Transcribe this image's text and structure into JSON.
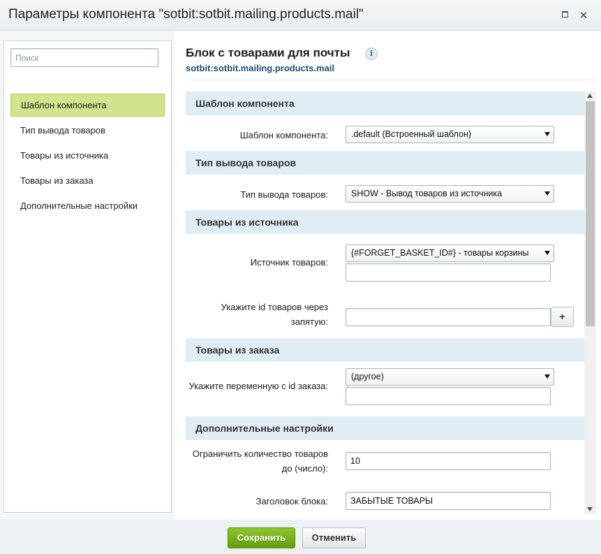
{
  "window": {
    "title": "Параметры компонента \"sotbit:sotbit.mailing.products.mail\""
  },
  "sidebar": {
    "search_placeholder": "Поиск",
    "items": [
      {
        "label": "Шаблон компонента"
      },
      {
        "label": "Тип вывода товаров"
      },
      {
        "label": "Товары из источника"
      },
      {
        "label": "Товары из заказа"
      },
      {
        "label": "Дополнительные настройки"
      }
    ]
  },
  "main": {
    "title": "Блок с товарами для почты",
    "subtitle": "sotbit:sotbit.mailing.products.mail",
    "info_glyph": "i"
  },
  "sections": {
    "template": {
      "title": "Шаблон компонента",
      "field_label": "Шаблон компонента:",
      "field_value": ".default (Встроенный шаблон)"
    },
    "output_type": {
      "title": "Тип вывода товаров",
      "field_label": "Тип вывода товаров:",
      "field_value": "SHOW - Вывод товаров из источника"
    },
    "source": {
      "title": "Товары из источника",
      "source_label": "Источник товаров:",
      "source_value": "{#FORGET_BASKET_ID#} - товары корзины",
      "source_extra_value": "",
      "ids_label_line1": "Укажите id товаров через",
      "ids_label_line2": "запятую:",
      "ids_value": "",
      "add_label": "+"
    },
    "order": {
      "title": "Товары из заказа",
      "var_label": "Укажите переменную с id заказа:",
      "var_value": "(другое)",
      "var_extra_value": ""
    },
    "extra": {
      "title": "Дополнительные настройки",
      "limit_label_line1": "Ограничить количество товаров",
      "limit_label_line2": "до (число):",
      "limit_value": "10",
      "block_title_label": "Заголовок блока:",
      "block_title_value": "ЗАБЫТЫЕ ТОВАРЫ"
    }
  },
  "footer": {
    "save_label": "Сохранить",
    "cancel_label": "Отменить"
  },
  "colors": {
    "accent_green": "#8ec62e",
    "active_nav": "#cfe48c",
    "section_bg": "#e1edf5",
    "subtitle_blue": "#1c4f74"
  }
}
